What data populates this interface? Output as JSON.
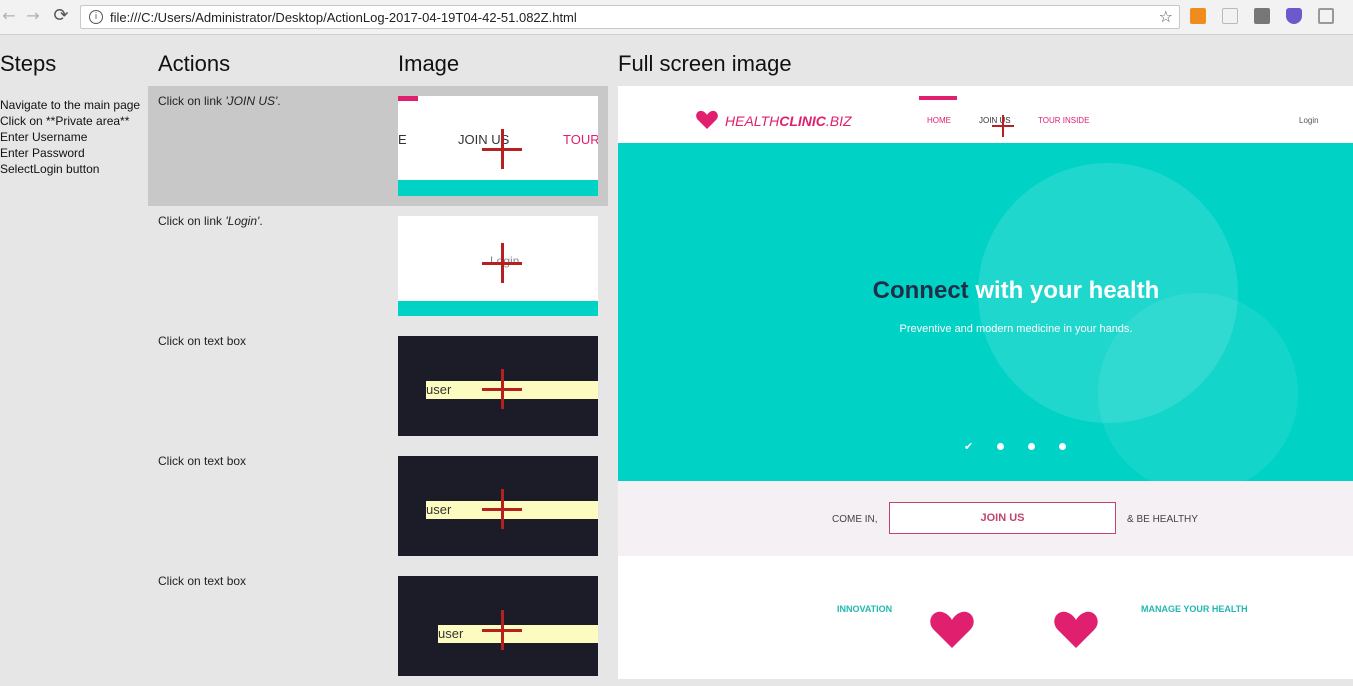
{
  "browser": {
    "back_icon": "←",
    "forward_icon": "→",
    "reload_icon": "⟳",
    "url": "file:///C:/Users/Administrator/Desktop/ActionLog-2017-04-19T04-42-51.082Z.html",
    "star_icon": "☆"
  },
  "headers": {
    "steps": "Steps",
    "actions": "Actions",
    "image": "Image",
    "full": "Full screen image"
  },
  "steps": [
    "Navigate to the main page",
    "Click on **Private area**",
    "Enter Username",
    "Enter Password",
    "SelectLogin button"
  ],
  "actions": [
    {
      "prefix": "Click on link ",
      "target": "'JOIN US'",
      "suffix": ".",
      "thumb_text": "JOIN US",
      "thumb_side": "TOUR",
      "thumb_left": "E"
    },
    {
      "prefix": "Click on link ",
      "target": "'Login'",
      "suffix": ".",
      "thumb_text": "Login"
    },
    {
      "prefix": "Click on text box",
      "target": "",
      "suffix": "",
      "thumb_text": "user"
    },
    {
      "prefix": "Click on text box",
      "target": "",
      "suffix": "",
      "thumb_text": "user"
    },
    {
      "prefix": "Click on text box",
      "target": "",
      "suffix": "",
      "thumb_text": "user"
    }
  ],
  "site": {
    "logo_plain": "HEALTH",
    "logo_accent": "CLINIC",
    "logo_suffix": ".BIZ",
    "nav": [
      "HOME",
      "JOIN US",
      "TOUR INSIDE"
    ],
    "login": "Login",
    "hero_title_dark": "Connect",
    "hero_title_light": " with your health",
    "hero_subtitle": "Preventive and modern medicine in your hands.",
    "cta_left": "COME IN,",
    "cta_button": "JOIN US",
    "cta_right": "& BE HEALTHY",
    "feature_left": "INNOVATION",
    "feature_right": "MANAGE YOUR HEALTH"
  },
  "colors": {
    "teal": "#00d2c6",
    "pink": "#e0206e",
    "crosshair": "#b52020",
    "dark_navy": "#1f2f47"
  }
}
